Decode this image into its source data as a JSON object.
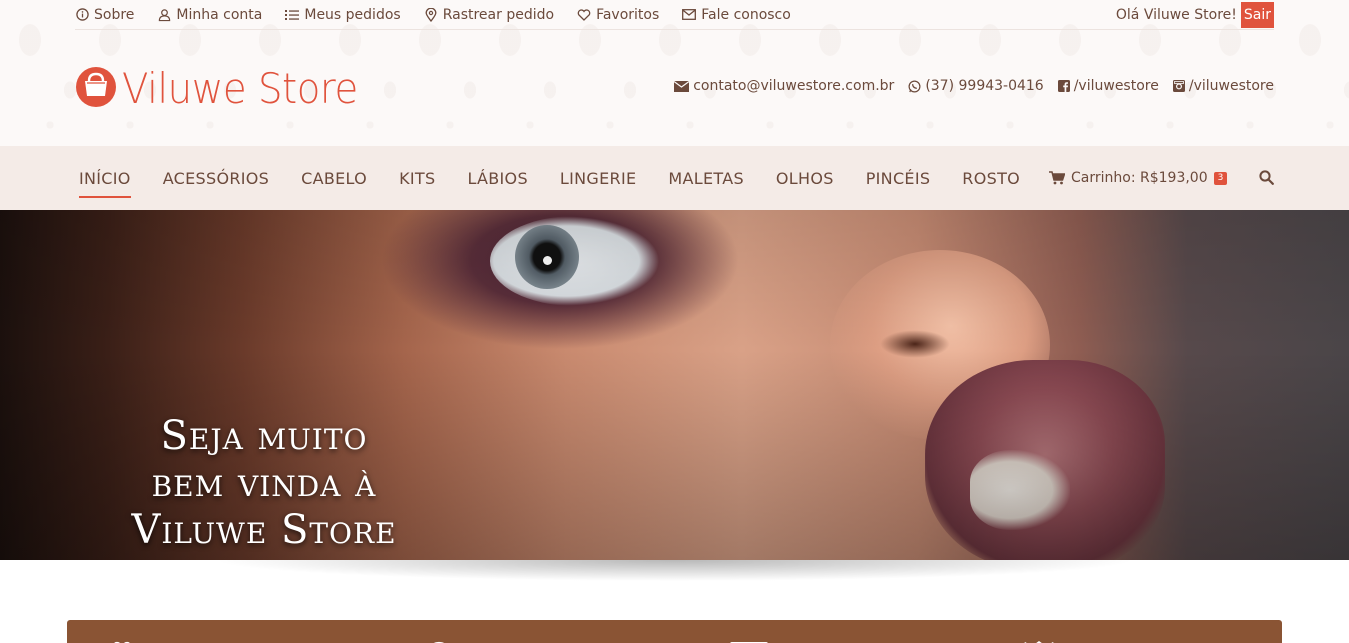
{
  "topbar": {
    "links": [
      {
        "icon": "info-icon",
        "label": "Sobre"
      },
      {
        "icon": "user-icon",
        "label": "Minha conta"
      },
      {
        "icon": "list-icon",
        "label": "Meus pedidos"
      },
      {
        "icon": "map-pin-icon",
        "label": "Rastrear pedido"
      },
      {
        "icon": "heart-icon",
        "label": "Favoritos"
      },
      {
        "icon": "envelope-icon",
        "label": "Fale conosco"
      }
    ],
    "greeting": "Olá Viluwe Store!",
    "logout_label": "Sair"
  },
  "logo": {
    "text": "Viluwe Store",
    "color": "#e0533d"
  },
  "contacts": {
    "email": "contato@viluwestore.com.br",
    "whatsapp": "(37) 99943-0416",
    "facebook": "/viluwestore",
    "instagram": "/viluwestore"
  },
  "nav": {
    "items": [
      {
        "label": "INÍCIO",
        "active": true
      },
      {
        "label": "ACESSÓRIOS",
        "active": false
      },
      {
        "label": "CABELO",
        "active": false
      },
      {
        "label": "KITS",
        "active": false
      },
      {
        "label": "LÁBIOS",
        "active": false
      },
      {
        "label": "LINGERIE",
        "active": false
      },
      {
        "label": "MALETAS",
        "active": false
      },
      {
        "label": "OLHOS",
        "active": false
      },
      {
        "label": "PINCÉIS",
        "active": false
      },
      {
        "label": "ROSTO",
        "active": false
      }
    ],
    "cart_label": "Carrinho: R$193,00",
    "cart_count": "3"
  },
  "hero": {
    "headline_line1": "Seja muito",
    "headline_line2": "bem vinda à",
    "headline_line3": "Viluwe Store"
  },
  "colors": {
    "accent": "#e0533d",
    "text": "#6b4a3c",
    "nav_bg": "#f4ebe7",
    "feature_bar": "#8a5434"
  }
}
